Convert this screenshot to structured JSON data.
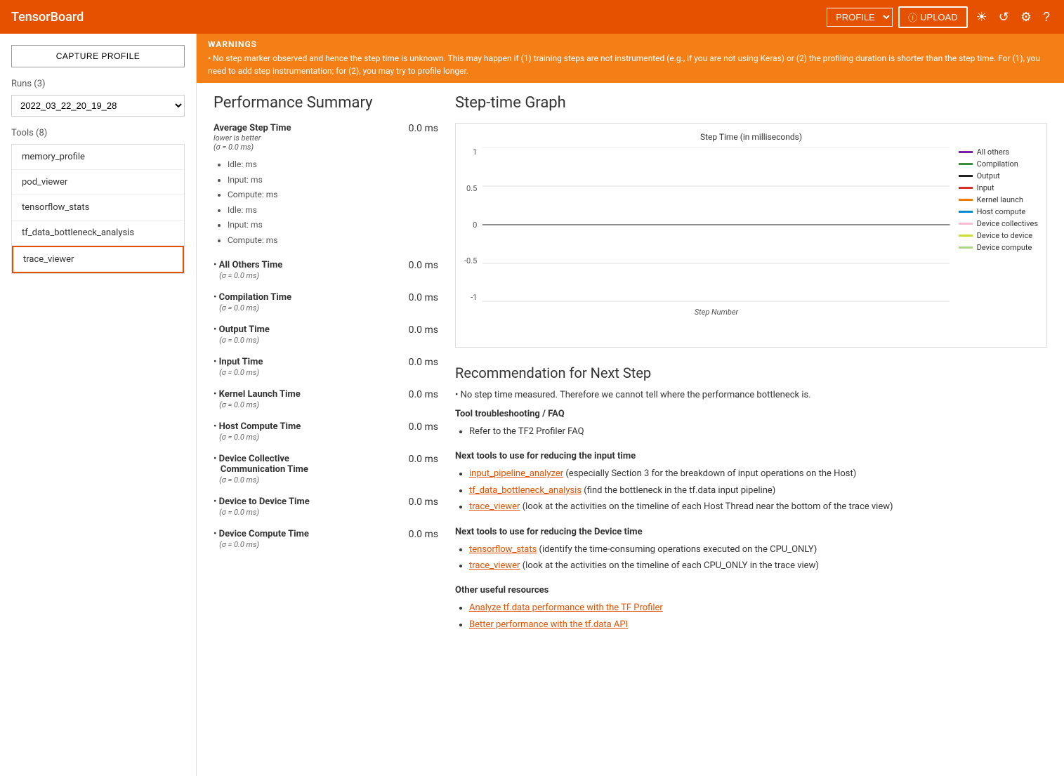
{
  "header": {
    "title": "TensorBoard",
    "profile_label": "PROFILE",
    "upload_label": "UPLOAD",
    "icons": [
      "brightness",
      "refresh",
      "settings",
      "help"
    ]
  },
  "sidebar": {
    "capture_btn": "CAPTURE PROFILE",
    "runs_label": "Runs (3)",
    "runs_value": "2022_03_22_20_19_28",
    "tools_label": "Tools (8)",
    "tools": [
      {
        "id": "memory_profile",
        "label": "memory_profile",
        "active": false
      },
      {
        "id": "pod_viewer",
        "label": "pod_viewer",
        "active": false
      },
      {
        "id": "tensorflow_stats",
        "label": "tensorflow_stats",
        "active": false
      },
      {
        "id": "tf_data_bottleneck_analysis",
        "label": "tf_data_bottleneck_analysis",
        "active": false
      },
      {
        "id": "trace_viewer",
        "label": "trace_viewer",
        "active": true
      }
    ]
  },
  "warnings": {
    "title": "WARNINGS",
    "text": "No step marker observed and hence the step time is unknown. This may happen if (1) training steps are not instrumented (e.g., if you are not using Keras) or (2) the profiling duration is shorter than the step time. For (1), you need to add step instrumentation; for (2), you may try to profile longer."
  },
  "performance_summary": {
    "title": "Performance Summary",
    "avg_step": {
      "label": "Average Step Time",
      "sublabel1": "lower is better",
      "sublabel2": "(σ = 0.0 ms)",
      "value": "0.0 ms"
    },
    "sub_items": [
      "Idle: ms",
      "Input: ms",
      "Compute: ms",
      "Idle: ms",
      "Input: ms",
      "Compute: ms"
    ],
    "metrics": [
      {
        "label": "All Others Time",
        "sub": "(σ = 0.0 ms)",
        "value": "0.0 ms"
      },
      {
        "label": "Compilation Time",
        "sub": "(σ = 0.0 ms)",
        "value": "0.0 ms"
      },
      {
        "label": "Output Time",
        "sub": "(σ = 0.0 ms)",
        "value": "0.0 ms"
      },
      {
        "label": "Input Time",
        "sub": "(σ = 0.0 ms)",
        "value": "0.0 ms"
      },
      {
        "label": "Kernel Launch Time",
        "sub": "(σ = 0.0 ms)",
        "value": "0.0 ms"
      },
      {
        "label": "Host Compute Time",
        "sub": "(σ = 0.0 ms)",
        "value": "0.0 ms"
      },
      {
        "label": "Device Collective Communication Time",
        "sub": "(σ = 0.0 ms)",
        "value": "0.0 ms"
      },
      {
        "label": "Device to Device Time",
        "sub": "(σ = 0.0 ms)",
        "value": "0.0 ms"
      },
      {
        "label": "Device Compute Time",
        "sub": "(σ = 0.0 ms)",
        "value": "0.0 ms"
      }
    ]
  },
  "step_time_graph": {
    "title": "Step-time Graph",
    "graph_title": "Step Time (in milliseconds)",
    "y_labels": [
      "1",
      "0.5",
      "0",
      "-0.5",
      "-1"
    ],
    "x_label": "Step Number",
    "legend": [
      {
        "label": "All others",
        "color": "#7B1FA2"
      },
      {
        "label": "Compilation",
        "color": "#388E3C"
      },
      {
        "label": "Output",
        "color": "#212121"
      },
      {
        "label": "Input",
        "color": "#D32F2F"
      },
      {
        "label": "Kernel launch",
        "color": "#F57C00"
      },
      {
        "label": "Host compute",
        "color": "#0288D1"
      },
      {
        "label": "Device collectives",
        "color": "#F8BBD0"
      },
      {
        "label": "Device to device",
        "color": "#CDDC39"
      },
      {
        "label": "Device compute",
        "color": "#AED581"
      }
    ]
  },
  "recommendation": {
    "title": "Recommendation for Next Step",
    "no_step_text": "No step time measured. Therefore we cannot tell where the performance bottleneck is.",
    "tool_faq_label": "Tool troubleshooting / FAQ",
    "tool_faq_item": "Refer to the TF2 Profiler FAQ",
    "next_input_label": "Next tools to use for reducing the input time",
    "next_input_items": [
      {
        "link": "input_pipeline_analyzer",
        "rest": " (especially Section 3 for the breakdown of input operations on the Host)"
      },
      {
        "link": "tf_data_bottleneck_analysis",
        "rest": " (find the bottleneck in the tf.data input pipeline)"
      },
      {
        "link": "trace_viewer",
        "rest": " (look at the activities on the timeline of each Host Thread near the bottom of the trace view)"
      }
    ],
    "next_device_label": "Next tools to use for reducing the Device time",
    "next_device_items": [
      {
        "link": "tensorflow_stats",
        "rest": " (identify the time-consuming operations executed on the CPU_ONLY)"
      },
      {
        "link": "trace_viewer",
        "rest": " (look at the activities on the timeline of each CPU_ONLY in the trace view)"
      }
    ],
    "other_label": "Other useful resources",
    "other_items": [
      {
        "link": "Analyze tf.data performance with the TF Profiler"
      },
      {
        "link": "Better performance with the tf.data API"
      }
    ]
  }
}
